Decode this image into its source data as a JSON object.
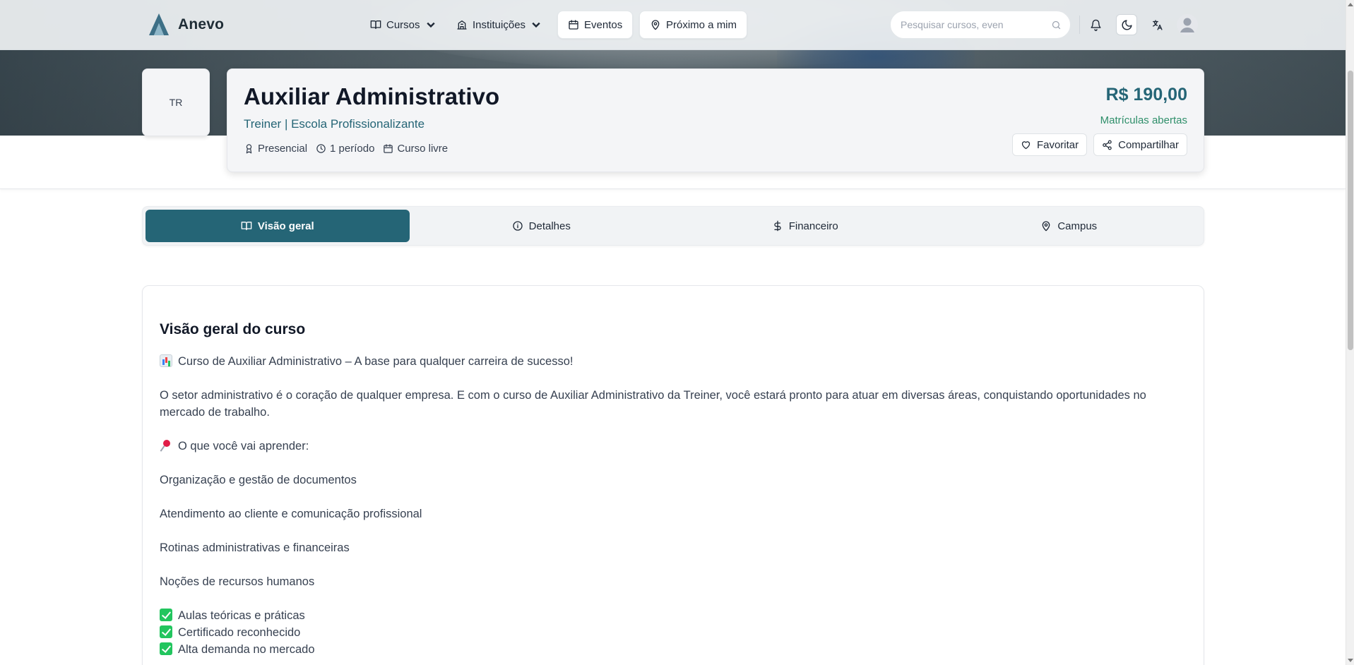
{
  "brand": {
    "name": "Anevo"
  },
  "nav": {
    "cursos": "Cursos",
    "instituicoes": "Instituições",
    "eventos": "Eventos",
    "proximo": "Próximo a mim",
    "search_placeholder": "Pesquisar cursos, even"
  },
  "course": {
    "badge": "TR",
    "title": "Auxiliar Administrativo",
    "institution": "Treiner | Escola Profissionalizante",
    "modality": "Presencial",
    "duration": "1 período",
    "type": "Curso livre",
    "price": "R$ 190,00",
    "status": "Matrículas abertas",
    "favorite_label": "Favoritar",
    "share_label": "Compartilhar"
  },
  "tabs": [
    {
      "label": "Visão geral",
      "active": true
    },
    {
      "label": "Detalhes"
    },
    {
      "label": "Financeiro"
    },
    {
      "label": "Campus"
    }
  ],
  "overview": {
    "heading": "Visão geral do curso",
    "intro": "Curso de Auxiliar Administrativo – A base para qualquer carreira de sucesso!",
    "paragraph": "O setor administrativo é o coração de qualquer empresa. E com o curso de Auxiliar Administrativo da Treiner, você estará pronto para atuar em diversas áreas, conquistando oportunidades no mercado de trabalho.",
    "learn_heading": "O que você vai aprender:",
    "topics": [
      "Organização e gestão de documentos",
      "Atendimento ao cliente e comunicação profissional",
      "Rotinas administrativas e financeiras",
      "Noções de recursos humanos"
    ],
    "benefits": [
      "Aulas teóricas e práticas",
      "Certificado reconhecido",
      "Alta demanda no mercado"
    ]
  },
  "colors": {
    "primary": "#256576",
    "success": "#2f8f6a",
    "navbar": "#eef1f3"
  }
}
